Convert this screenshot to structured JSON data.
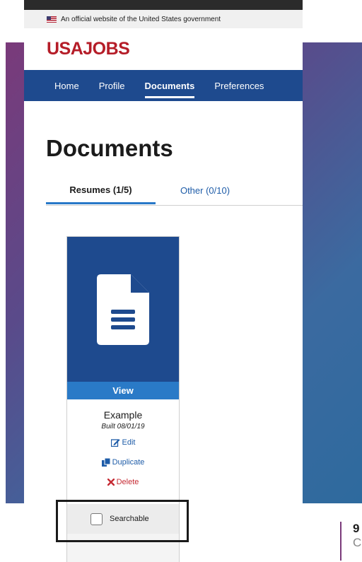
{
  "gov_banner": {
    "text": "An official website of the United States government"
  },
  "logo": {
    "text": "USAJOBS"
  },
  "nav": {
    "items": [
      {
        "label": "Home"
      },
      {
        "label": "Profile"
      },
      {
        "label": "Documents"
      },
      {
        "label": "Preferences"
      }
    ]
  },
  "page": {
    "title": "Documents"
  },
  "tabs": [
    {
      "label": "Resumes (1/5)"
    },
    {
      "label": "Other (0/10)"
    }
  ],
  "card": {
    "view_label": "View",
    "name": "Example",
    "built": "Built 08/01/19",
    "edit_label": "Edit",
    "duplicate_label": "Duplicate",
    "delete_label": "Delete",
    "searchable_label": "Searchable",
    "searchable_checked": false
  },
  "fragment": {
    "title": "9",
    "sub": "C"
  },
  "colors": {
    "brand_red": "#b51d28",
    "nav_blue": "#1e4a8e",
    "link_blue": "#1e5ca8",
    "view_blue": "#2a7ac7",
    "delete_red": "#c62b34"
  }
}
